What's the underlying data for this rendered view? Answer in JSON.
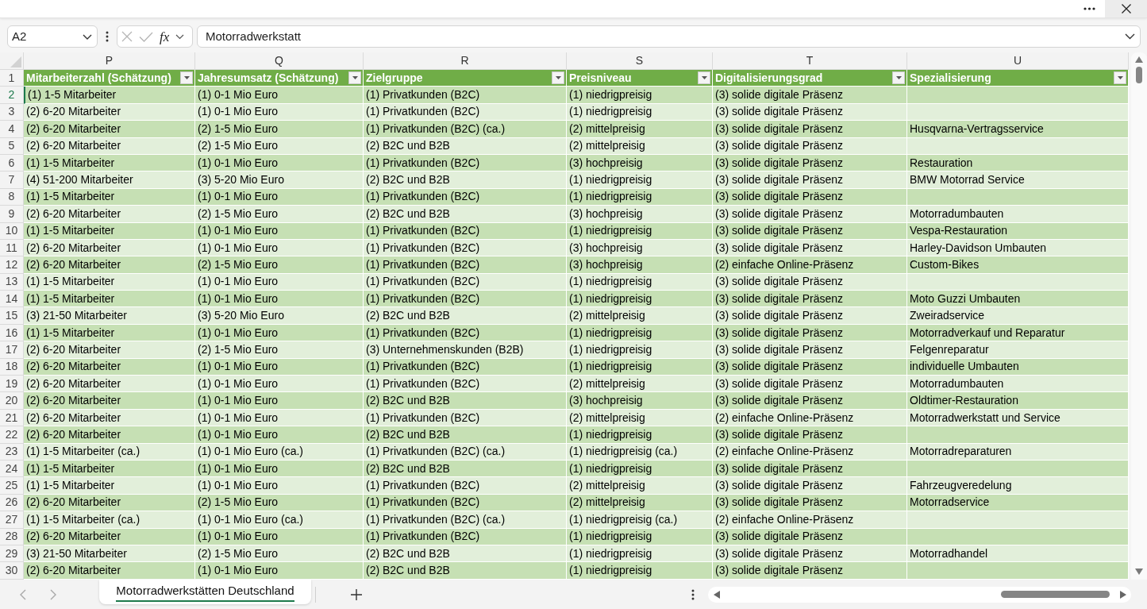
{
  "formula_bar": {
    "cell_reference": "A2",
    "function_label": "fx",
    "formula": "Motorradwerkstatt"
  },
  "table": {
    "header_row": {
      "number": "1"
    },
    "columns": [
      {
        "letter": "P",
        "header": "Mitarbeiterzahl (Schätzung)"
      },
      {
        "letter": "Q",
        "header": "Jahresumsatz (Schätzung)"
      },
      {
        "letter": "R",
        "header": "Zielgruppe"
      },
      {
        "letter": "S",
        "header": "Preisniveau"
      },
      {
        "letter": "T",
        "header": "Digitalisierungsgrad"
      },
      {
        "letter": "U",
        "header": "Spezialisierung"
      }
    ],
    "rows": [
      {
        "number": "2",
        "selected": true,
        "cells": [
          "(1) 1-5 Mitarbeiter",
          "(1) 0-1 Mio Euro",
          "(1) Privatkunden (B2C)",
          "(1) niedrigpreisig",
          "(3) solide digitale Präsenz"
        ]
      },
      {
        "number": "3",
        "selected": false,
        "cells": [
          "(2) 6-20 Mitarbeiter",
          "(1) 0-1 Mio Euro",
          "(1) Privatkunden (B2C)",
          "(1) niedrigpreisig",
          "(3) solide digitale Präsenz"
        ]
      },
      {
        "number": "4",
        "selected": false,
        "cells": [
          "(2) 6-20 Mitarbeiter",
          "(2) 1-5 Mio Euro",
          "(1) Privatkunden (B2C) (ca.)",
          "(2) mittelpreisig",
          "(3) solide digitale Präsenz",
          "Husqvarna-Vertragsservice"
        ]
      },
      {
        "number": "5",
        "selected": false,
        "cells": [
          "(2) 6-20 Mitarbeiter",
          "(2) 1-5 Mio Euro",
          "(2) B2C und B2B",
          "(2) mittelpreisig",
          "(3) solide digitale Präsenz"
        ]
      },
      {
        "number": "6",
        "selected": false,
        "cells": [
          "(1) 1-5 Mitarbeiter",
          "(1) 0-1 Mio Euro",
          "(1) Privatkunden (B2C)",
          "(3) hochpreisig",
          "(3) solide digitale Präsenz",
          "Restauration"
        ]
      },
      {
        "number": "7",
        "selected": false,
        "cells": [
          "(4) 51-200 Mitarbeiter",
          "(3) 5-20 Mio Euro",
          "(2) B2C und B2B",
          "(1) niedrigpreisig",
          "(3) solide digitale Präsenz",
          "BMW Motorrad Service"
        ]
      },
      {
        "number": "8",
        "selected": false,
        "cells": [
          "(1) 1-5 Mitarbeiter",
          "(1) 0-1 Mio Euro",
          "(1) Privatkunden (B2C)",
          "(1) niedrigpreisig",
          "(3) solide digitale Präsenz"
        ]
      },
      {
        "number": "9",
        "selected": false,
        "cells": [
          "(2) 6-20 Mitarbeiter",
          "(2) 1-5 Mio Euro",
          "(2) B2C und B2B",
          "(3) hochpreisig",
          "(3) solide digitale Präsenz",
          "Motorradumbauten"
        ]
      },
      {
        "number": "10",
        "selected": false,
        "cells": [
          "(1) 1-5 Mitarbeiter",
          "(1) 0-1 Mio Euro",
          "(1) Privatkunden (B2C)",
          "(1) niedrigpreisig",
          "(3) solide digitale Präsenz",
          "Vespa-Restauration"
        ]
      },
      {
        "number": "11",
        "selected": false,
        "cells": [
          "(2) 6-20 Mitarbeiter",
          "(1) 0-1 Mio Euro",
          "(1) Privatkunden (B2C)",
          "(3) hochpreisig",
          "(3) solide digitale Präsenz",
          "Harley-Davidson Umbauten"
        ]
      },
      {
        "number": "12",
        "selected": false,
        "cells": [
          "(2) 6-20 Mitarbeiter",
          "(2) 1-5 Mio Euro",
          "(1) Privatkunden (B2C)",
          "(3) hochpreisig",
          "(2) einfache Online-Präsenz",
          "Custom-Bikes"
        ]
      },
      {
        "number": "13",
        "selected": false,
        "cells": [
          "(1) 1-5 Mitarbeiter",
          "(1) 0-1 Mio Euro",
          "(1) Privatkunden (B2C)",
          "(1) niedrigpreisig",
          "(3) solide digitale Präsenz"
        ]
      },
      {
        "number": "14",
        "selected": false,
        "cells": [
          "(1) 1-5 Mitarbeiter",
          "(1) 0-1 Mio Euro",
          "(1) Privatkunden (B2C)",
          "(1) niedrigpreisig",
          "(3) solide digitale Präsenz",
          "Moto Guzzi Umbauten"
        ]
      },
      {
        "number": "15",
        "selected": false,
        "cells": [
          "(3) 21-50 Mitarbeiter",
          "(3) 5-20 Mio Euro",
          "(2) B2C und B2B",
          "(2) mittelpreisig",
          "(3) solide digitale Präsenz",
          "Zweiradservice"
        ]
      },
      {
        "number": "16",
        "selected": false,
        "cells": [
          "(1) 1-5 Mitarbeiter",
          "(1) 0-1 Mio Euro",
          "(1) Privatkunden (B2C)",
          "(1) niedrigpreisig",
          "(3) solide digitale Präsenz",
          "Motorradverkauf und Reparatur"
        ]
      },
      {
        "number": "17",
        "selected": false,
        "cells": [
          "(2) 6-20 Mitarbeiter",
          "(2) 1-5 Mio Euro",
          "(3) Unternehmenskunden (B2B)",
          "(1) niedrigpreisig",
          "(3) solide digitale Präsenz",
          "Felgenreparatur"
        ]
      },
      {
        "number": "18",
        "selected": false,
        "cells": [
          "(2) 6-20 Mitarbeiter",
          "(1) 0-1 Mio Euro",
          "(1) Privatkunden (B2C)",
          "(1) niedrigpreisig",
          "(3) solide digitale Präsenz",
          "individuelle Umbauten"
        ]
      },
      {
        "number": "19",
        "selected": false,
        "cells": [
          "(2) 6-20 Mitarbeiter",
          "(1) 0-1 Mio Euro",
          "(1) Privatkunden (B2C)",
          "(2) mittelpreisig",
          "(3) solide digitale Präsenz",
          "Motorradumbauten"
        ]
      },
      {
        "number": "20",
        "selected": false,
        "cells": [
          "(2) 6-20 Mitarbeiter",
          "(1) 0-1 Mio Euro",
          "(2) B2C und B2B",
          "(3) hochpreisig",
          "(3) solide digitale Präsenz",
          "Oldtimer-Restauration"
        ]
      },
      {
        "number": "21",
        "selected": false,
        "cells": [
          "(2) 6-20 Mitarbeiter",
          "(1) 0-1 Mio Euro",
          "(1) Privatkunden (B2C)",
          "(2) mittelpreisig",
          "(2) einfache Online-Präsenz",
          "Motorradwerkstatt und Service"
        ]
      },
      {
        "number": "22",
        "selected": false,
        "cells": [
          "(2) 6-20 Mitarbeiter",
          "(1) 0-1 Mio Euro",
          "(2) B2C und B2B",
          "(1) niedrigpreisig",
          "(3) solide digitale Präsenz"
        ]
      },
      {
        "number": "23",
        "selected": false,
        "cells": [
          "(1) 1-5 Mitarbeiter (ca.)",
          "(1) 0-1 Mio Euro (ca.)",
          "(1) Privatkunden (B2C) (ca.)",
          "(1) niedrigpreisig (ca.)",
          "(2) einfache Online-Präsenz",
          "Motorradreparaturen"
        ]
      },
      {
        "number": "24",
        "selected": false,
        "cells": [
          "(1) 1-5 Mitarbeiter",
          "(1) 0-1 Mio Euro",
          "(2) B2C und B2B",
          "(1) niedrigpreisig",
          "(3) solide digitale Präsenz"
        ]
      },
      {
        "number": "25",
        "selected": false,
        "cells": [
          "(1) 1-5 Mitarbeiter",
          "(1) 0-1 Mio Euro",
          "(1) Privatkunden (B2C)",
          "(2) mittelpreisig",
          "(3) solide digitale Präsenz",
          "Fahrzeugveredelung"
        ]
      },
      {
        "number": "26",
        "selected": false,
        "cells": [
          "(2) 6-20 Mitarbeiter",
          "(2) 1-5 Mio Euro",
          "(1) Privatkunden (B2C)",
          "(2) mittelpreisig",
          "(3) solide digitale Präsenz",
          "Motorradservice"
        ]
      },
      {
        "number": "27",
        "selected": false,
        "cells": [
          "(1) 1-5 Mitarbeiter (ca.)",
          "(1) 0-1 Mio Euro (ca.)",
          "(1) Privatkunden (B2C) (ca.)",
          "(1) niedrigpreisig (ca.)",
          "(2) einfache Online-Präsenz"
        ]
      },
      {
        "number": "28",
        "selected": false,
        "cells": [
          "(2) 6-20 Mitarbeiter",
          "(1) 0-1 Mio Euro",
          "(1) Privatkunden (B2C)",
          "(1) niedrigpreisig",
          "(3) solide digitale Präsenz"
        ]
      },
      {
        "number": "29",
        "selected": false,
        "cells": [
          "(3) 21-50 Mitarbeiter",
          "(2) 1-5 Mio Euro",
          "(2) B2C und B2B",
          "(1) niedrigpreisig",
          "(3) solide digitale Präsenz",
          "Motorradhandel"
        ]
      },
      {
        "number": "30",
        "selected": false,
        "cells": [
          "(2) 6-20 Mitarbeiter",
          "(1) 0-1 Mio Euro",
          "(2) B2C und B2B",
          "(1) niedrigpreisig",
          "(3) solide digitale Präsenz"
        ]
      }
    ]
  },
  "sheets": [
    {
      "label": "Motorradwerkstätten Deutschland",
      "selected": true
    }
  ]
}
